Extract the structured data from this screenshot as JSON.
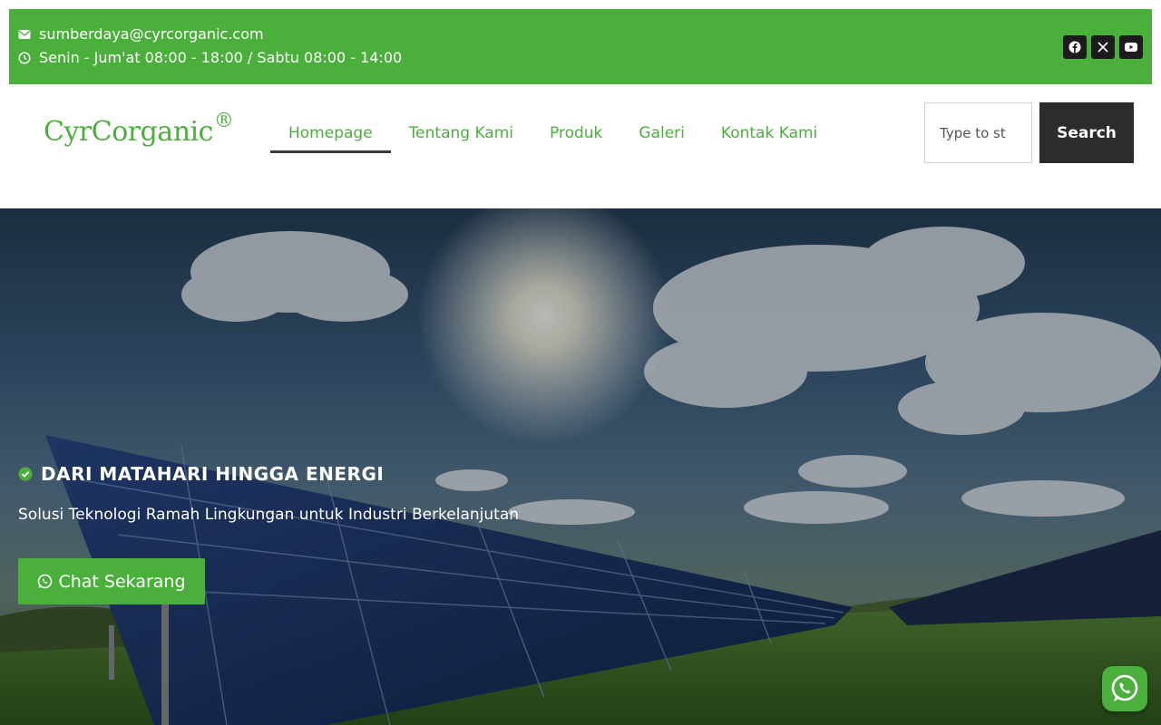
{
  "topbar": {
    "email": "sumberdaya@cyrcorganic.com",
    "hours": "Senin - Jum'at 08:00 - 18:00 / Sabtu 08:00 - 14:00",
    "bg_color": "#4baf3c",
    "social": [
      {
        "icon": "facebook-icon"
      },
      {
        "icon": "x-twitter-icon"
      },
      {
        "icon": "youtube-icon"
      }
    ]
  },
  "header": {
    "logo_text": "CyrCorganic",
    "logo_mark": "®",
    "nav": [
      {
        "label": "Homepage",
        "active": true
      },
      {
        "label": "Tentang Kami",
        "active": false
      },
      {
        "label": "Produk",
        "active": false
      },
      {
        "label": "Galeri",
        "active": false
      },
      {
        "label": "Kontak Kami",
        "active": false
      }
    ],
    "search": {
      "placeholder": "Type to st",
      "button_label": "Search"
    }
  },
  "hero": {
    "title": "DARI MATAHARI HINGGA ENERGI",
    "subtitle": "Solusi Teknologi Ramah Lingkungan untuk Industri Berkelanjutan",
    "cta_label": "Chat Sekarang"
  },
  "colors": {
    "accent": "#4baf3c",
    "dark": "#2c2c2c"
  }
}
